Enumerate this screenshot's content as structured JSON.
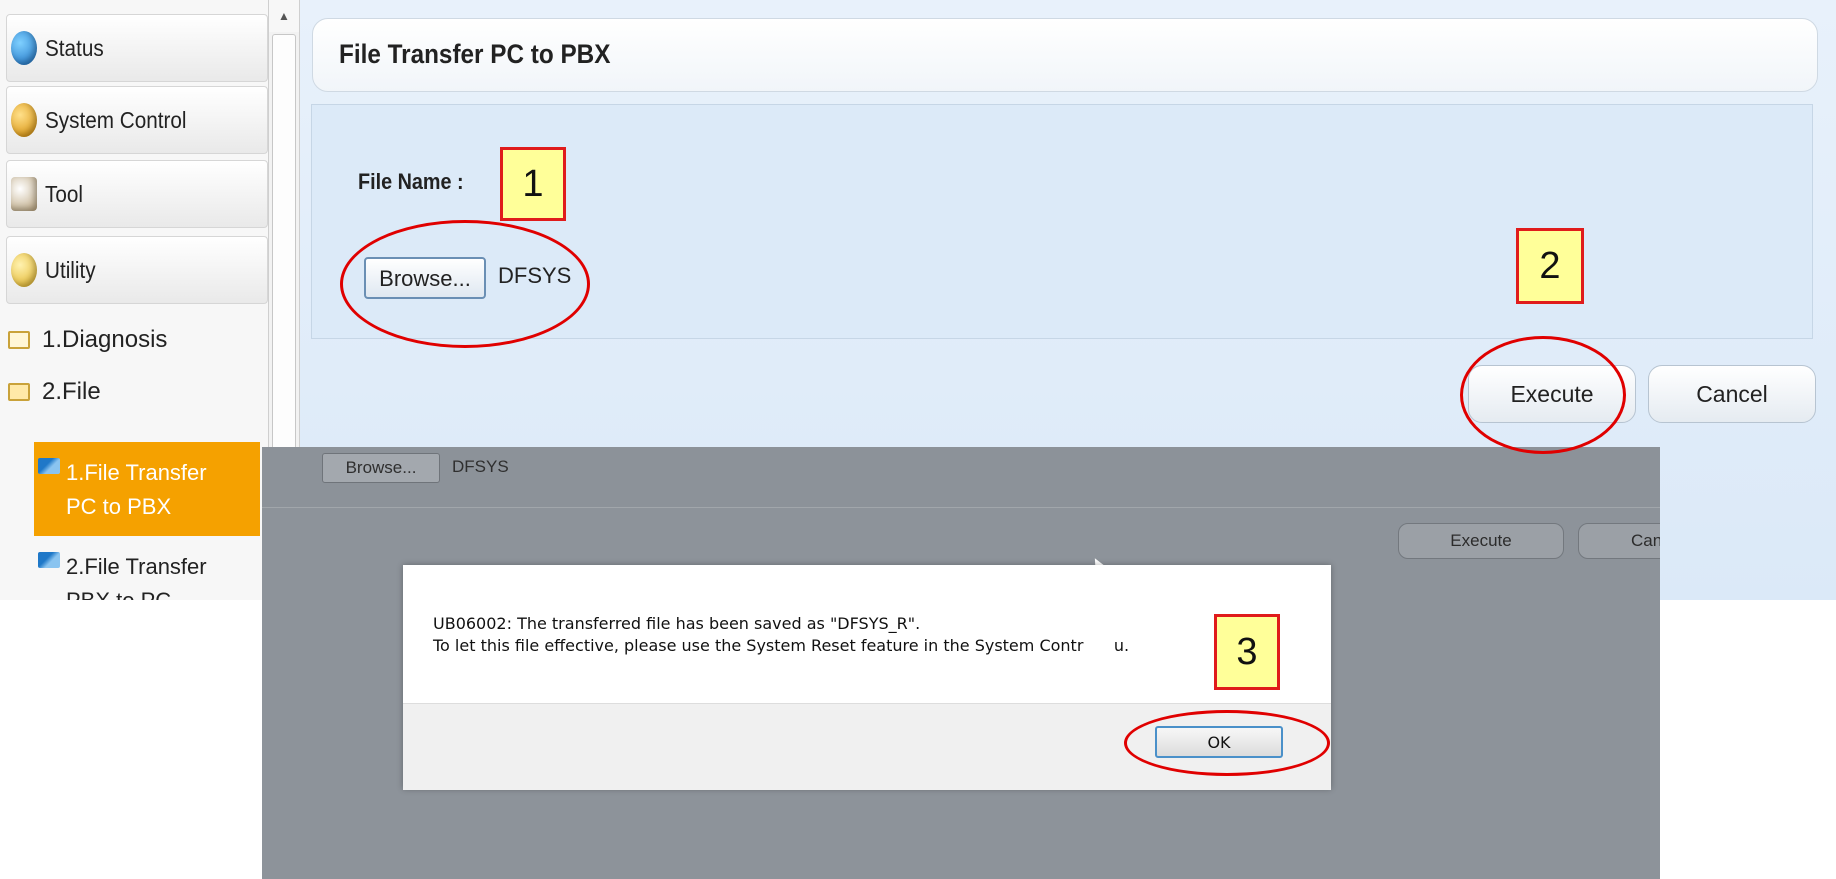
{
  "sidebar": {
    "menu": [
      {
        "label": "Status",
        "icon": "status-icon"
      },
      {
        "label": "System Control",
        "icon": "system-control-icon"
      },
      {
        "label": "Tool",
        "icon": "tool-icon"
      },
      {
        "label": "Utility",
        "icon": "utility-icon"
      }
    ],
    "tree": [
      {
        "label": "1.Diagnosis",
        "icon": "folder-icon"
      },
      {
        "label": "2.File",
        "icon": "folder-open-icon"
      }
    ],
    "subitems": [
      {
        "line1": "1.File Transfer",
        "line2": "PC to PBX",
        "active": true
      },
      {
        "line1": "2.File Transfer",
        "line2": "PBX to PC",
        "active": false
      }
    ]
  },
  "page": {
    "title": "File Transfer PC to PBX",
    "file_name_label": "File Name :",
    "browse_label": "Browse...",
    "file_value": "DFSYS",
    "execute_label": "Execute",
    "cancel_label": "Cancel"
  },
  "overlay": {
    "browse_label": "Browse...",
    "file_value": "DFSYS",
    "execute_label": "Execute",
    "cancel_label": "Can"
  },
  "dialog": {
    "message": "UB06002: The transferred file has been saved as \"DFSYS_R\".\nTo let this file effective, please use the System Reset feature in the System Contr      u.",
    "ok_label": "OK"
  },
  "annotations": {
    "step1": "1",
    "step2": "2",
    "step3": "3",
    "highlight_color": "#e01b1b",
    "callout_fill": "#ffff99"
  },
  "colors": {
    "accent_active": "#f5a100",
    "panel": "#dceaf8",
    "overlay": "#8d939a"
  }
}
